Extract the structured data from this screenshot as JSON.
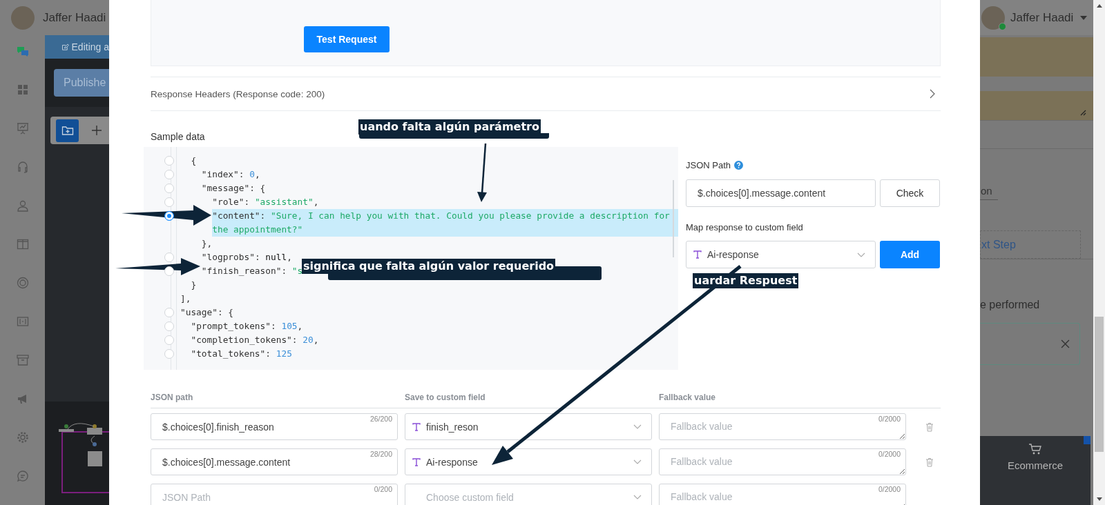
{
  "background_left": {
    "user_name": "Jaffer Haadi",
    "editing_label": "Editing a",
    "publish_button": "Publishe"
  },
  "background_right": {
    "user_name": "Jaffer Haadi",
    "field_fragment": "on",
    "next_step_fragment": "xt Step",
    "action_fragment": "e performed",
    "bottom_tab": "Ecommerce"
  },
  "modal": {
    "test_button": "Test Request",
    "response_headers": "Response Headers (Response code: 200)",
    "sample_data_label": "Sample data",
    "code_lines": [
      {
        "kind": "selectable",
        "selected": false,
        "highlighted": false,
        "tokens": [
          {
            "kind": "punct",
            "text": "  {"
          }
        ]
      },
      {
        "kind": "selectable",
        "selected": false,
        "highlighted": false,
        "tokens": [
          {
            "kind": "key",
            "text": "    \"index\""
          },
          {
            "kind": "punct",
            "text": ": "
          },
          {
            "kind": "number",
            "text": "0"
          },
          {
            "kind": "punct",
            "text": ","
          }
        ]
      },
      {
        "kind": "selectable",
        "selected": false,
        "highlighted": false,
        "tokens": [
          {
            "kind": "key",
            "text": "    \"message\""
          },
          {
            "kind": "punct",
            "text": ": {"
          }
        ]
      },
      {
        "kind": "selectable",
        "selected": false,
        "highlighted": false,
        "tokens": [
          {
            "kind": "key",
            "text": "      \"role\""
          },
          {
            "kind": "punct",
            "text": ": "
          },
          {
            "kind": "string",
            "text": "\"assistant\""
          },
          {
            "kind": "punct",
            "text": ","
          }
        ]
      },
      {
        "kind": "selectable",
        "selected": true,
        "highlighted": true,
        "tokens": [
          {
            "kind": "key",
            "text": "      \"content\""
          },
          {
            "kind": "punct",
            "text": ": "
          },
          {
            "kind": "string",
            "text": "\"Sure, I can help you with that. Could you please provide a description for"
          }
        ]
      },
      {
        "kind": "plain",
        "highlighted": true,
        "tokens": [
          {
            "kind": "string",
            "text": "      the appointment?\""
          }
        ]
      },
      {
        "kind": "plain",
        "highlighted": false,
        "tokens": [
          {
            "kind": "punct",
            "text": "    },"
          }
        ]
      },
      {
        "kind": "selectable",
        "selected": false,
        "highlighted": false,
        "tokens": [
          {
            "kind": "key",
            "text": "    \"logprobs\""
          },
          {
            "kind": "punct",
            "text": ": "
          },
          {
            "kind": "null",
            "text": "null"
          },
          {
            "kind": "punct",
            "text": ","
          }
        ]
      },
      {
        "kind": "selectable",
        "selected": false,
        "highlighted": false,
        "tokens": [
          {
            "kind": "key",
            "text": "    \"finish_reason\""
          },
          {
            "kind": "punct",
            "text": ": "
          },
          {
            "kind": "string",
            "text": "\"s"
          }
        ]
      },
      {
        "kind": "plain",
        "highlighted": false,
        "tokens": [
          {
            "kind": "punct",
            "text": "  }"
          }
        ]
      },
      {
        "kind": "plain",
        "highlighted": false,
        "tokens": [
          {
            "kind": "punct",
            "text": "],"
          }
        ]
      },
      {
        "kind": "selectable",
        "selected": false,
        "highlighted": false,
        "tokens": [
          {
            "kind": "key",
            "text": "\"usage\""
          },
          {
            "kind": "punct",
            "text": ": {"
          }
        ]
      },
      {
        "kind": "selectable",
        "selected": false,
        "highlighted": false,
        "tokens": [
          {
            "kind": "key",
            "text": "  \"prompt_tokens\""
          },
          {
            "kind": "punct",
            "text": ": "
          },
          {
            "kind": "number",
            "text": "105"
          },
          {
            "kind": "punct",
            "text": ","
          }
        ]
      },
      {
        "kind": "selectable",
        "selected": false,
        "highlighted": false,
        "tokens": [
          {
            "kind": "key",
            "text": "  \"completion_tokens\""
          },
          {
            "kind": "punct",
            "text": ": "
          },
          {
            "kind": "number",
            "text": "20"
          },
          {
            "kind": "punct",
            "text": ","
          }
        ]
      },
      {
        "kind": "selectable",
        "selected": false,
        "highlighted": false,
        "tokens": [
          {
            "kind": "key",
            "text": "  \"total_tokens\""
          },
          {
            "kind": "punct",
            "text": ": "
          },
          {
            "kind": "number",
            "text": "125"
          }
        ]
      }
    ],
    "json_path": {
      "label": "JSON Path",
      "value": "$.choices[0].message.content",
      "check_button": "Check"
    },
    "map_field": {
      "label": "Map response to custom field",
      "value": "Ai-response",
      "add_button": "Add"
    },
    "table": {
      "columns": [
        "JSON path",
        "Save to custom field",
        "Fallback value"
      ],
      "rows": [
        {
          "path": "$.choices[0].finish_reason",
          "path_counter": "26/200",
          "field": "finish_reson",
          "fallback_placeholder": "Fallback value",
          "fallback_counter": "0/2000"
        },
        {
          "path": "$.choices[0].message.content",
          "path_counter": "28/200",
          "field": "Ai-response",
          "fallback_placeholder": "Fallback value",
          "fallback_counter": "0/2000"
        },
        {
          "path_placeholder": "JSON Path",
          "path_counter": "0/200",
          "field_placeholder": "Choose custom field",
          "fallback_placeholder": "Fallback value",
          "fallback_counter": "0/2000"
        }
      ]
    }
  },
  "annotations": [
    {
      "text": "uando falta algún parámetro"
    },
    {
      "text": "significa que falta algún valor requerido"
    },
    {
      "text": "uardar Respuest"
    }
  ]
}
